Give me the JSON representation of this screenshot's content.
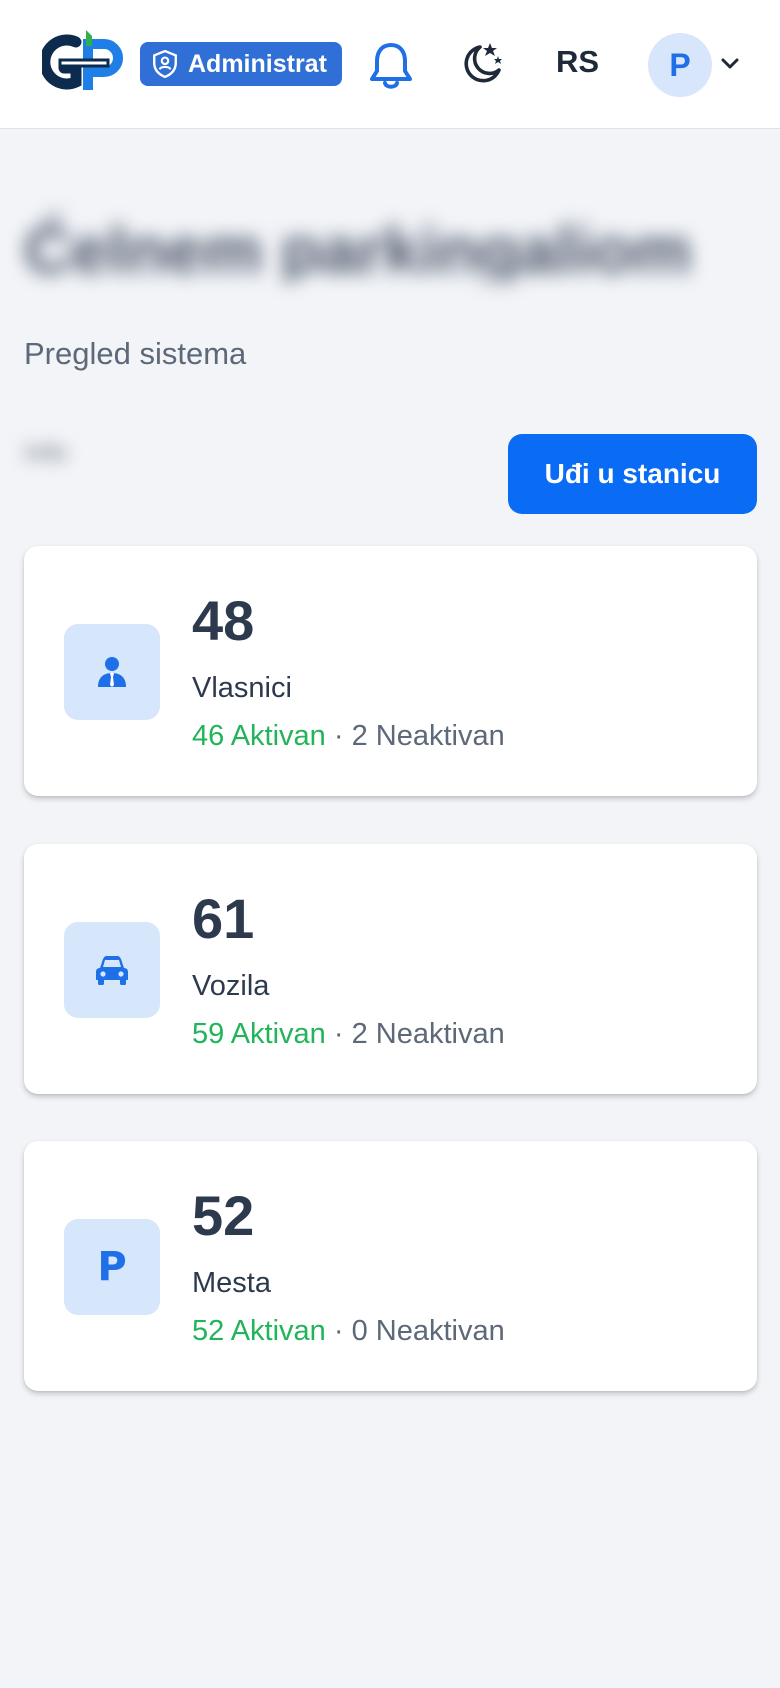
{
  "header": {
    "role_badge": "Administrat",
    "language": "RS",
    "avatar_initial": "P"
  },
  "page": {
    "title": "Ćelnem parkingaliom",
    "subtitle": "Pregled sistema",
    "blurred_meta": "Info",
    "enter_button": "Uđi u stanicu"
  },
  "cards": [
    {
      "value": "48",
      "label": "Vlasnici",
      "active": "46 Aktivan",
      "sep": " · ",
      "inactive": "2 Neaktivan",
      "icon": "person-icon"
    },
    {
      "value": "61",
      "label": "Vozila",
      "active": "59 Aktivan",
      "sep": " · ",
      "inactive": "2 Neaktivan",
      "icon": "car-icon"
    },
    {
      "value": "52",
      "label": "Mesta",
      "active": "52 Aktivan",
      "sep": " · ",
      "inactive": "0 Neaktivan",
      "icon": "parking-icon",
      "icon_text": "P"
    }
  ],
  "colors": {
    "accent": "#0a6cf5",
    "active_green": "#22b45a",
    "icon_bg": "#d6e6fb"
  }
}
